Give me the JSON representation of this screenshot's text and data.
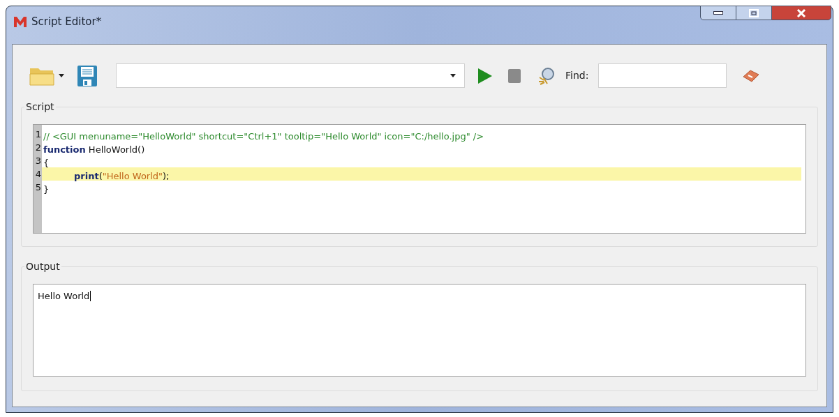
{
  "window": {
    "title": "Script Editor*"
  },
  "toolbar": {
    "find_label": "Find:"
  },
  "script": {
    "label": "Script",
    "lines": [
      {
        "number": "1",
        "selected": false,
        "indented": false,
        "tokens": [
          {
            "kind": "comment",
            "text": "// <GUI menuname=\"HelloWorld\" shortcut=\"Ctrl+1\" tooltip=\"Hello World\" icon=\"C:/hello.jpg\" />"
          }
        ]
      },
      {
        "number": "2",
        "selected": false,
        "indented": false,
        "tokens": [
          {
            "kind": "keyword",
            "text": "function"
          },
          {
            "kind": "plain",
            "text": " HelloWorld()"
          }
        ]
      },
      {
        "number": "3",
        "selected": false,
        "indented": false,
        "tokens": [
          {
            "kind": "plain",
            "text": "{"
          }
        ]
      },
      {
        "number": "4",
        "selected": true,
        "indented": true,
        "tokens": [
          {
            "kind": "keyword",
            "text": "print"
          },
          {
            "kind": "plain",
            "text": "("
          },
          {
            "kind": "string",
            "text": "\"Hello World\""
          },
          {
            "kind": "plain",
            "text": ");"
          }
        ]
      },
      {
        "number": "5",
        "selected": false,
        "indented": false,
        "tokens": [
          {
            "kind": "plain",
            "text": "}"
          }
        ]
      }
    ]
  },
  "output": {
    "label": "Output",
    "text": "Hello World"
  }
}
